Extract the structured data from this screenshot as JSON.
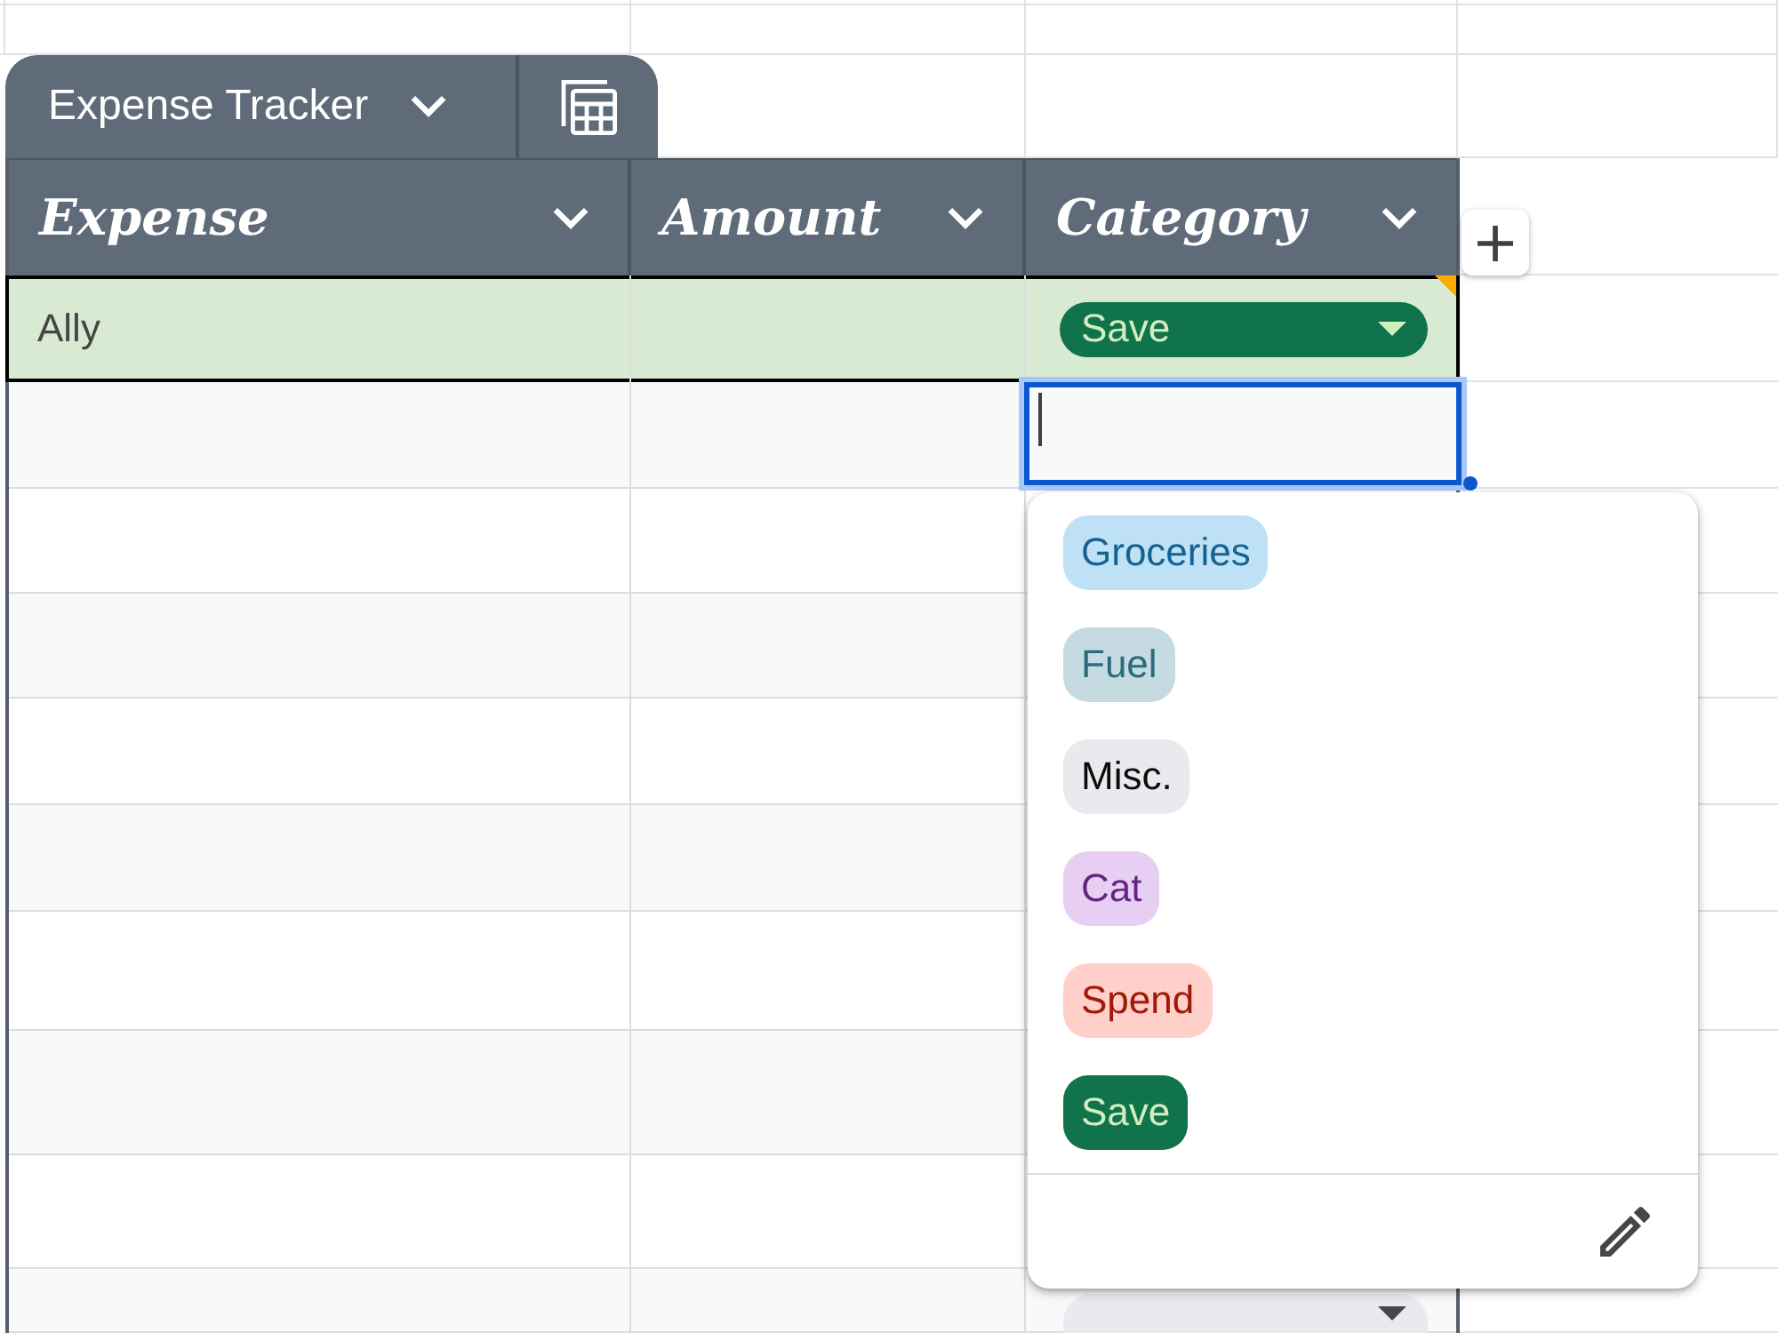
{
  "table_tab": {
    "title": "Expense Tracker"
  },
  "table": {
    "columns": [
      {
        "label": "Expense"
      },
      {
        "label": "Amount"
      },
      {
        "label": "Category"
      }
    ],
    "rows": [
      {
        "expense": "Ally",
        "category": {
          "label": "Save",
          "color": "#11734b"
        },
        "highlighted": true
      }
    ]
  },
  "dropdown": {
    "options": [
      {
        "label": "Groceries",
        "color": "#bfe1f6",
        "selected": false
      },
      {
        "label": "Fuel",
        "color": "#c6dbe1",
        "selected": false
      },
      {
        "label": "Misc.",
        "color": "#e8eaed",
        "selected": false
      },
      {
        "label": "Cat",
        "color": "#e6cff2",
        "selected": false
      },
      {
        "label": "Spend",
        "color": "#ffcfc9",
        "selected": false
      },
      {
        "label": "Save",
        "color": "#11734b",
        "selected": false
      }
    ]
  }
}
